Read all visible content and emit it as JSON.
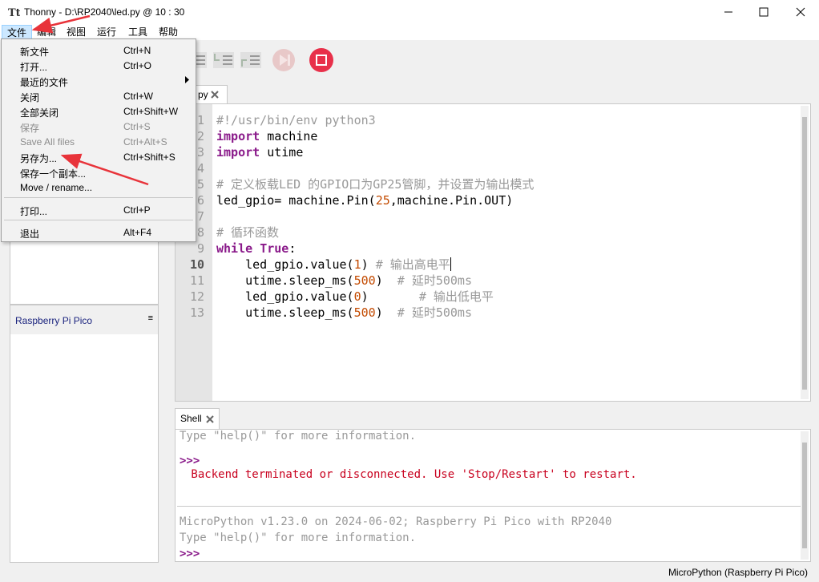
{
  "window": {
    "title": "Thonny  -  D:\\RP2040\\led.py  @  10 : 30",
    "controls": [
      "minimize-icon",
      "maximize-icon",
      "close-icon"
    ]
  },
  "menubar": [
    "文件",
    "编辑",
    "视图",
    "运行",
    "工具",
    "帮助"
  ],
  "file_menu": {
    "items": [
      {
        "label": "新文件",
        "shortcut": "Ctrl+N",
        "enabled": true
      },
      {
        "label": "打开...",
        "shortcut": "Ctrl+O",
        "enabled": true
      },
      {
        "label": "最近的文件",
        "shortcut": "",
        "submenu": true,
        "enabled": true
      },
      {
        "label": "关闭",
        "shortcut": "Ctrl+W",
        "enabled": true
      },
      {
        "label": "全部关闭",
        "shortcut": "Ctrl+Shift+W",
        "enabled": true
      },
      {
        "label": "保存",
        "shortcut": "Ctrl+S",
        "enabled": false
      },
      {
        "label": "Save All files",
        "shortcut": "Ctrl+Alt+S",
        "enabled": false
      },
      {
        "label": "另存为...",
        "shortcut": "Ctrl+Shift+S",
        "enabled": true
      },
      {
        "label": "保存一个副本...",
        "shortcut": "",
        "enabled": true
      },
      {
        "label": "Move / rename...",
        "shortcut": "",
        "enabled": true
      },
      {
        "label": "打印...",
        "shortcut": "Ctrl+P",
        "enabled": true
      },
      {
        "label": "退出",
        "shortcut": "Alt+F4",
        "enabled": true
      }
    ]
  },
  "toolbar": {
    "icons": [
      "step-over-icon",
      "step-into-icon",
      "step-out-icon",
      "resume-icon",
      "stop-icon"
    ]
  },
  "left_pane": {
    "device_label": "Raspberry Pi Pico",
    "menu_glyph": "≡"
  },
  "editor": {
    "tab_label": "py",
    "line_numbers": [
      "1",
      "2",
      "3",
      "4",
      "5",
      "6",
      "7",
      "8",
      "9",
      "10",
      "11",
      "12",
      "13"
    ],
    "current_line": "10",
    "lines": [
      [
        {
          "t": "#!/usr/bin/env python3",
          "c": "cm"
        }
      ],
      [
        {
          "t": "import",
          "c": "kw"
        },
        {
          "t": " machine",
          "c": ""
        }
      ],
      [
        {
          "t": "import",
          "c": "kw"
        },
        {
          "t": " utime",
          "c": ""
        }
      ],
      [],
      [
        {
          "t": "# 定义板载LED 的GPIO口为GP25管脚，并设置为输出模式",
          "c": "cm"
        }
      ],
      [
        {
          "t": "led_gpio= machine.Pin(",
          "c": ""
        },
        {
          "t": "25",
          "c": "num"
        },
        {
          "t": ",machine.Pin.OUT)",
          "c": ""
        }
      ],
      [],
      [
        {
          "t": "# 循环函数",
          "c": "cm"
        }
      ],
      [
        {
          "t": "while",
          "c": "kw"
        },
        {
          "t": " ",
          "c": ""
        },
        {
          "t": "True",
          "c": "kw"
        },
        {
          "t": ":",
          "c": ""
        }
      ],
      [
        {
          "t": "    led_gpio.value(",
          "c": ""
        },
        {
          "t": "1",
          "c": "num"
        },
        {
          "t": ") ",
          "c": ""
        },
        {
          "t": "# 输出高电平",
          "c": "cm"
        },
        {
          "t": "",
          "c": "caret"
        }
      ],
      [
        {
          "t": "    utime.sleep_ms(",
          "c": ""
        },
        {
          "t": "500",
          "c": "num"
        },
        {
          "t": ")  ",
          "c": ""
        },
        {
          "t": "# 延时500ms",
          "c": "cm"
        }
      ],
      [
        {
          "t": "    led_gpio.value(",
          "c": ""
        },
        {
          "t": "0",
          "c": "num"
        },
        {
          "t": ")       ",
          "c": ""
        },
        {
          "t": "# 输出低电平",
          "c": "cm"
        }
      ],
      [
        {
          "t": "    utime.sleep_ms(",
          "c": ""
        },
        {
          "t": "500",
          "c": "num"
        },
        {
          "t": ")  ",
          "c": ""
        },
        {
          "t": "# 延时500ms",
          "c": "cm"
        }
      ]
    ]
  },
  "shell": {
    "tab_label": "Shell",
    "line1": "Type \"help()\" for more information.",
    "prompt1": ">>>",
    "error": " Backend terminated or disconnected. Use 'Stop/Restart' to restart.",
    "banner": "MicroPython v1.23.0 on 2024-06-02; Raspberry Pi Pico with RP2040",
    "line2": "Type \"help()\" for more information.",
    "prompt2": ">>>"
  },
  "statusbar": {
    "interpreter": "MicroPython (Raspberry Pi Pico)"
  },
  "colors": {
    "annotation_arrow": "#e8333a",
    "stop_button": "#e8304a",
    "keyword": "#8a1a8a",
    "number": "#c34a00",
    "error": "#c8001e"
  }
}
